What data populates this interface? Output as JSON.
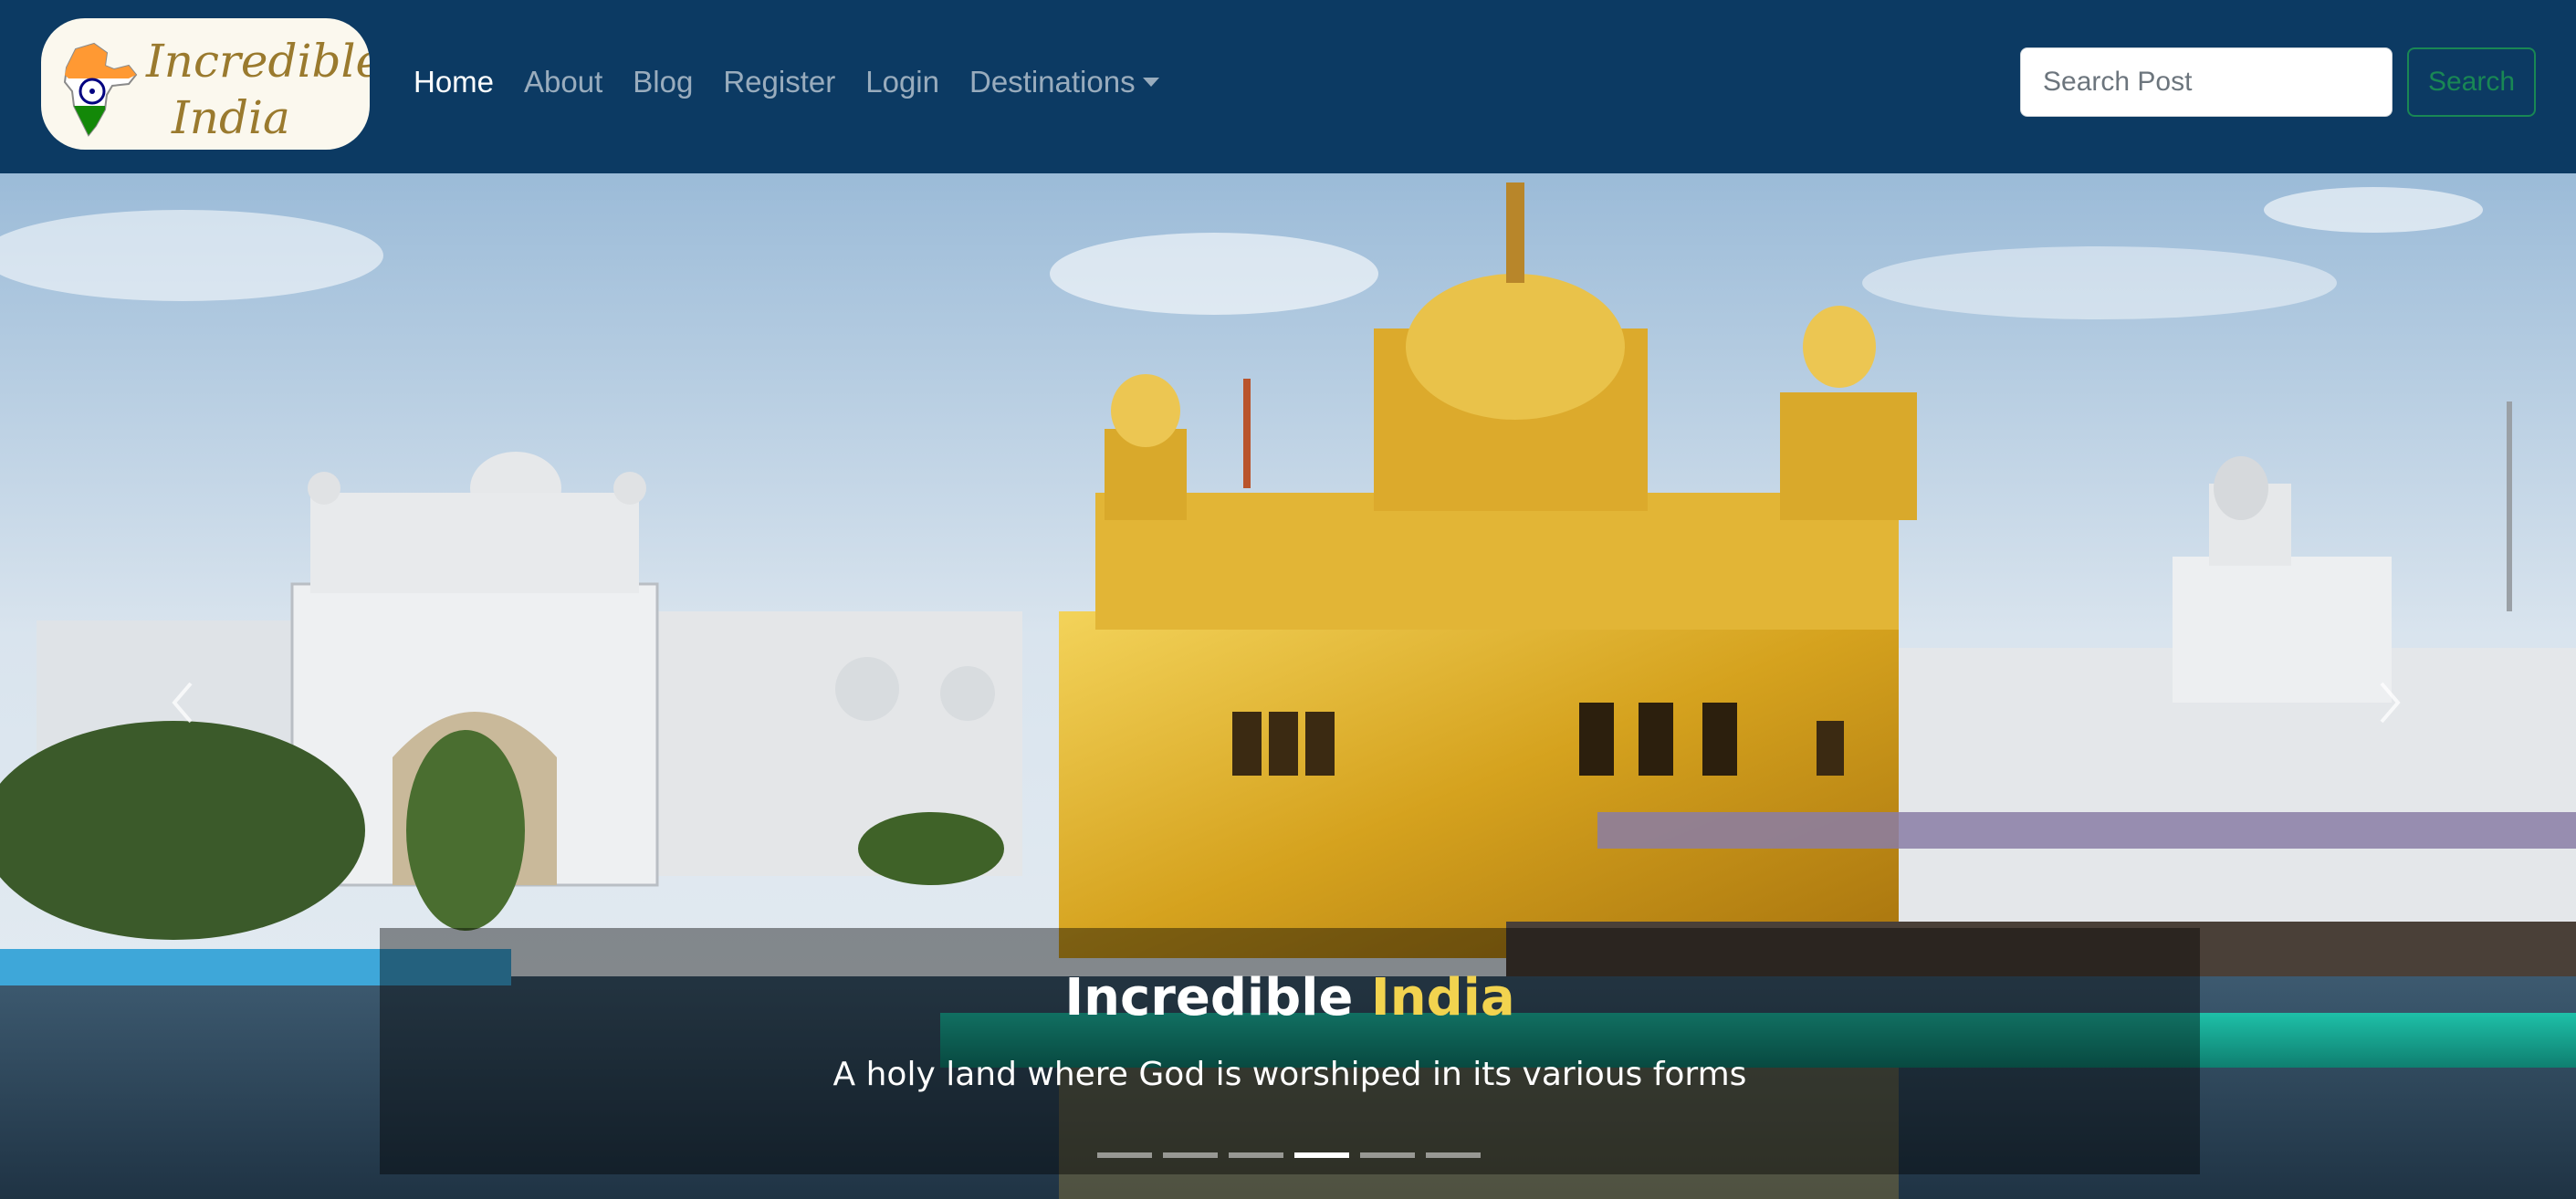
{
  "brand": {
    "line1": "Incredible",
    "line2": "India",
    "accent_color": "#9a7a2e"
  },
  "nav": {
    "items": [
      {
        "label": "Home",
        "active": true
      },
      {
        "label": "About"
      },
      {
        "label": "Blog"
      },
      {
        "label": "Register"
      },
      {
        "label": "Login"
      },
      {
        "label": "Destinations",
        "dropdown": true
      }
    ]
  },
  "search": {
    "placeholder": "Search Post",
    "value": "",
    "button_label": "Search",
    "button_color": "#198754"
  },
  "carousel": {
    "caption_title_part1": "Incredible",
    "caption_title_part2": "India",
    "caption_subtitle": "A holy land where God is worshiped in its various forms",
    "highlight_color": "#f2d34f",
    "slide_count": 6,
    "active_slide": 4,
    "prev_icon": "chevron-left-icon",
    "next_icon": "chevron-right-icon"
  },
  "colors": {
    "navbar_bg": "#0c3a63"
  }
}
